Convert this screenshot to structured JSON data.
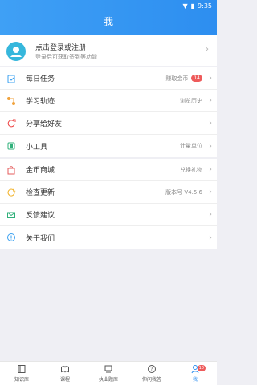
{
  "status": {
    "time": "9:35"
  },
  "header": {
    "title": "我"
  },
  "profile": {
    "title": "点击登录或注册",
    "subtitle": "登录后可获取签到等功能"
  },
  "sections": [
    {
      "items": [
        {
          "label": "每日任务",
          "right": "赚取金币",
          "badge": "14",
          "icon": "task-icon"
        },
        {
          "label": "学习轨迹",
          "right": "浏览历史",
          "icon": "track-icon"
        },
        {
          "label": "分享给好友",
          "right": "",
          "icon": "share-icon"
        },
        {
          "label": "小工具",
          "right": "计量单位",
          "icon": "tool-icon"
        }
      ]
    },
    {
      "items": [
        {
          "label": "金币商城",
          "right": "兑换礼物",
          "icon": "shop-icon"
        },
        {
          "label": "检查更新",
          "right": "版本号 V4.5.6",
          "icon": "update-icon"
        },
        {
          "label": "反馈建议",
          "right": "",
          "icon": "feedback-icon"
        },
        {
          "label": "关于我们",
          "right": "",
          "icon": "info-icon"
        }
      ]
    }
  ],
  "tabbar": {
    "tabs": [
      {
        "label": "知识库",
        "icon": "book-icon"
      },
      {
        "label": "课程",
        "icon": "course-icon"
      },
      {
        "label": "执业题库",
        "icon": "question-bank-icon"
      },
      {
        "label": "你问我答",
        "icon": "qa-icon"
      },
      {
        "label": "我",
        "icon": "user-icon",
        "badge": "10",
        "active": true
      }
    ]
  },
  "colors": {
    "primary": "#2d8ef0",
    "badge": "#ee5b5b"
  }
}
